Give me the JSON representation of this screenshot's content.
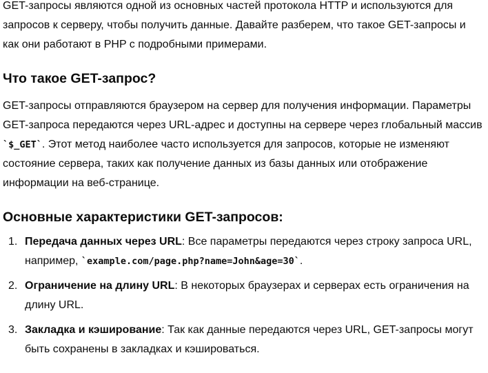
{
  "intro": "GET-запросы являются одной из основных частей протокола HTTP и используются для запросов к серверу, чтобы получить данные. Давайте разберем, что такое GET-запросы и как они работают в PHP с подробными примерами.",
  "section1": {
    "heading": "Что такое GET-запрос?",
    "text_before": "GET-запросы отправляются браузером на сервер для получения информации. Параметры GET-запроса передаются через URL-адрес и доступны на сервере через глобальный массив ",
    "code": "`$_GET`",
    "text_after": ". Этот метод наиболее часто используется для запросов, которые не изменяют состояние сервера, таких как получение данных из базы данных или отображение информации на веб-странице."
  },
  "section2": {
    "heading": "Основные характеристики GET-запросов:",
    "items": [
      {
        "number": "1.",
        "title": "Передача данных через URL",
        "text": ": Все параметры передаются через строку запроса URL, например, ",
        "code": "`example.com/page.php?name=John&age=30`",
        "text_after": "."
      },
      {
        "number": "2.",
        "title": "Ограничение на длину URL",
        "text": ": В некоторых браузерах и серверах есть ограничения на длину URL."
      },
      {
        "number": "3.",
        "title": "Закладка и кэширование",
        "text": ": Так как данные передаются через URL, GET-запросы могут быть сохранены в закладках и кэшироваться."
      }
    ]
  }
}
